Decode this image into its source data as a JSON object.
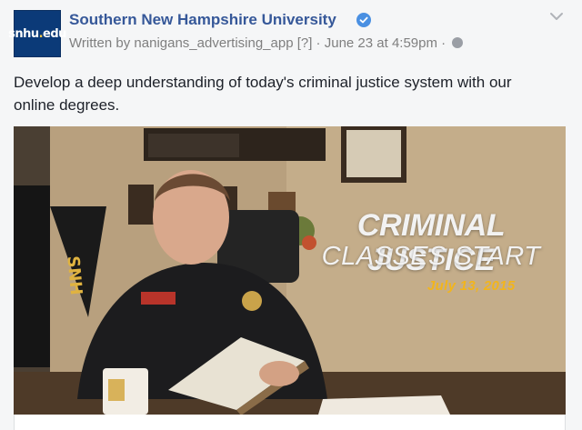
{
  "post": {
    "avatar_text_main": "snhu",
    "avatar_text_dot": ".",
    "avatar_text_tld": "edu",
    "page_name": "Southern New Hampshire University",
    "byline": "Written by nanigans_advertising_app [?] · June 23 at 4:59pm · ",
    "message_line1": "Develop a deep understanding of today's criminal justice system with our",
    "message_line2": "online degrees."
  },
  "image": {
    "headline": "CRIMINAL JUSTICE",
    "subhead": "CLASSES START",
    "date": "July 13, 2015",
    "pennant_text": "SNH"
  },
  "colors": {
    "link_blue": "#365899",
    "verified_blue": "#4a90e2",
    "date_gold": "#f2b51c"
  },
  "icons": [
    "verified-badge-icon",
    "globe-icon",
    "chevron-down-icon"
  ]
}
